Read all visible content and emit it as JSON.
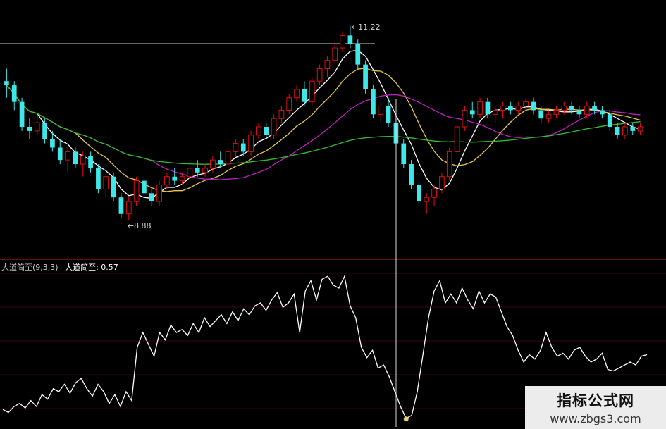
{
  "chart_data": [
    {
      "type": "candlestick",
      "panel": "price",
      "annotations": {
        "high_label": "11.22",
        "low_label": "8.88"
      },
      "reference_line_price": 11.0,
      "y_range": [
        8.6,
        11.4
      ],
      "colors": {
        "up": "#e01010",
        "down": "#3ee8e8",
        "ma5": "#ffffff",
        "ma10": "#e6c84a",
        "ma20": "#c020c0",
        "ma60": "#30c030"
      },
      "candles": [
        [
          10.55,
          10.7,
          10.35,
          10.5
        ],
        [
          10.5,
          10.55,
          10.2,
          10.3
        ],
        [
          10.3,
          10.35,
          9.95,
          10.0
        ],
        [
          10.0,
          10.1,
          9.85,
          9.95
        ],
        [
          9.95,
          10.15,
          9.9,
          10.05
        ],
        [
          10.05,
          10.1,
          9.8,
          9.85
        ],
        [
          9.85,
          9.95,
          9.7,
          9.75
        ],
        [
          9.75,
          9.85,
          9.55,
          9.6
        ],
        [
          9.6,
          9.75,
          9.45,
          9.7
        ],
        [
          9.7,
          9.75,
          9.5,
          9.55
        ],
        [
          9.55,
          9.7,
          9.4,
          9.65
        ],
        [
          9.65,
          9.7,
          9.45,
          9.5
        ],
        [
          9.5,
          9.55,
          9.2,
          9.25
        ],
        [
          9.25,
          9.45,
          9.15,
          9.4
        ],
        [
          9.4,
          9.45,
          9.1,
          9.15
        ],
        [
          9.15,
          9.2,
          8.9,
          8.95
        ],
        [
          8.95,
          9.15,
          8.88,
          9.1
        ],
        [
          9.1,
          9.4,
          9.05,
          9.35
        ],
        [
          9.35,
          9.4,
          9.15,
          9.2
        ],
        [
          9.2,
          9.25,
          9.05,
          9.1
        ],
        [
          9.1,
          9.35,
          9.05,
          9.3
        ],
        [
          9.3,
          9.45,
          9.25,
          9.4
        ],
        [
          9.4,
          9.5,
          9.3,
          9.35
        ],
        [
          9.35,
          9.45,
          9.3,
          9.4
        ],
        [
          9.4,
          9.55,
          9.35,
          9.5
        ],
        [
          9.5,
          9.6,
          9.4,
          9.45
        ],
        [
          9.45,
          9.55,
          9.4,
          9.5
        ],
        [
          9.5,
          9.65,
          9.45,
          9.6
        ],
        [
          9.6,
          9.7,
          9.5,
          9.55
        ],
        [
          9.55,
          9.75,
          9.5,
          9.7
        ],
        [
          9.7,
          9.85,
          9.65,
          9.8
        ],
        [
          9.8,
          9.85,
          9.65,
          9.7
        ],
        [
          9.7,
          9.95,
          9.65,
          9.9
        ],
        [
          9.9,
          10.05,
          9.85,
          10.0
        ],
        [
          10.0,
          10.05,
          9.85,
          9.9
        ],
        [
          9.9,
          10.15,
          9.85,
          10.1
        ],
        [
          10.1,
          10.25,
          10.05,
          10.2
        ],
        [
          10.2,
          10.4,
          10.15,
          10.35
        ],
        [
          10.35,
          10.5,
          10.3,
          10.45
        ],
        [
          10.45,
          10.55,
          10.25,
          10.3
        ],
        [
          10.3,
          10.6,
          10.25,
          10.55
        ],
        [
          10.55,
          10.75,
          10.5,
          10.7
        ],
        [
          10.7,
          10.85,
          10.6,
          10.8
        ],
        [
          10.8,
          11.0,
          10.75,
          10.95
        ],
        [
          10.95,
          11.15,
          10.9,
          11.1
        ],
        [
          11.1,
          11.22,
          10.95,
          11.0
        ],
        [
          11.0,
          11.05,
          10.7,
          10.75
        ],
        [
          10.75,
          10.8,
          10.4,
          10.45
        ],
        [
          10.45,
          10.5,
          10.1,
          10.15
        ],
        [
          10.15,
          10.3,
          10.05,
          10.25
        ],
        [
          10.25,
          10.35,
          10.0,
          10.05
        ],
        [
          10.05,
          10.1,
          9.75,
          9.8
        ],
        [
          9.8,
          9.85,
          9.5,
          9.55
        ],
        [
          9.55,
          9.6,
          9.25,
          9.3
        ],
        [
          9.3,
          9.35,
          9.05,
          9.1
        ],
        [
          9.1,
          9.2,
          8.95,
          9.15
        ],
        [
          9.15,
          9.3,
          9.05,
          9.25
        ],
        [
          9.25,
          9.45,
          9.2,
          9.4
        ],
        [
          9.4,
          9.75,
          9.35,
          9.7
        ],
        [
          9.7,
          10.05,
          9.65,
          10.0
        ],
        [
          10.0,
          10.25,
          9.95,
          10.2
        ],
        [
          10.2,
          10.3,
          10.1,
          10.15
        ],
        [
          10.15,
          10.35,
          10.1,
          10.3
        ],
        [
          10.3,
          10.35,
          10.1,
          10.15
        ],
        [
          10.15,
          10.25,
          10.05,
          10.2
        ],
        [
          10.2,
          10.3,
          10.1,
          10.25
        ],
        [
          10.25,
          10.3,
          10.15,
          10.2
        ],
        [
          10.2,
          10.3,
          10.15,
          10.25
        ],
        [
          10.25,
          10.35,
          10.2,
          10.3
        ],
        [
          10.3,
          10.35,
          10.15,
          10.2
        ],
        [
          10.2,
          10.25,
          10.05,
          10.1
        ],
        [
          10.1,
          10.2,
          10.05,
          10.15
        ],
        [
          10.15,
          10.25,
          10.1,
          10.2
        ],
        [
          10.2,
          10.3,
          10.15,
          10.25
        ],
        [
          10.25,
          10.3,
          10.15,
          10.2
        ],
        [
          10.2,
          10.25,
          10.1,
          10.15
        ],
        [
          10.15,
          10.3,
          10.1,
          10.25
        ],
        [
          10.25,
          10.3,
          10.15,
          10.2
        ],
        [
          10.2,
          10.25,
          10.1,
          10.15
        ],
        [
          10.15,
          10.2,
          9.95,
          10.0
        ],
        [
          10.0,
          10.05,
          9.85,
          9.9
        ],
        [
          9.9,
          10.05,
          9.85,
          10.0
        ],
        [
          10.0,
          10.05,
          9.9,
          9.95
        ],
        [
          9.95,
          10.05,
          9.9,
          10.0
        ]
      ]
    },
    {
      "type": "line",
      "panel": "indicator",
      "title": "大道简至(9,3,3)",
      "series": [
        {
          "name": "大道简至",
          "current_value": "0.57",
          "color": "#ffffff",
          "values": [
            0.08,
            0.06,
            0.1,
            0.12,
            0.09,
            0.14,
            0.1,
            0.18,
            0.15,
            0.22,
            0.2,
            0.25,
            0.19,
            0.26,
            0.29,
            0.22,
            0.17,
            0.25,
            0.2,
            0.12,
            0.18,
            0.1,
            0.2,
            0.14,
            0.5,
            0.6,
            0.52,
            0.44,
            0.6,
            0.55,
            0.65,
            0.6,
            0.62,
            0.58,
            0.66,
            0.6,
            0.7,
            0.64,
            0.68,
            0.72,
            0.66,
            0.74,
            0.68,
            0.76,
            0.72,
            0.78,
            0.8,
            0.75,
            0.82,
            0.87,
            0.77,
            0.8,
            0.86,
            0.6,
            0.88,
            0.95,
            0.82,
            0.96,
            0.98,
            0.92,
            0.9,
            0.98,
            0.78,
            0.7,
            0.5,
            0.43,
            0.48,
            0.36,
            0.38,
            0.3,
            0.2,
            0.1,
            0.02,
            0.04,
            0.2,
            0.45,
            0.7,
            0.88,
            0.95,
            0.8,
            0.86,
            0.8,
            0.9,
            0.82,
            0.76,
            0.88,
            0.8,
            0.86,
            0.84,
            0.74,
            0.64,
            0.58,
            0.48,
            0.4,
            0.45,
            0.42,
            0.48,
            0.6,
            0.5,
            0.44,
            0.46,
            0.42,
            0.48,
            0.5,
            0.44,
            0.4,
            0.42,
            0.46,
            0.35,
            0.34,
            0.36,
            0.38,
            0.4,
            0.38,
            0.44,
            0.45
          ]
        }
      ]
    }
  ],
  "watermark": {
    "title": "指标公式网",
    "url": "www.zbgs3.com"
  }
}
